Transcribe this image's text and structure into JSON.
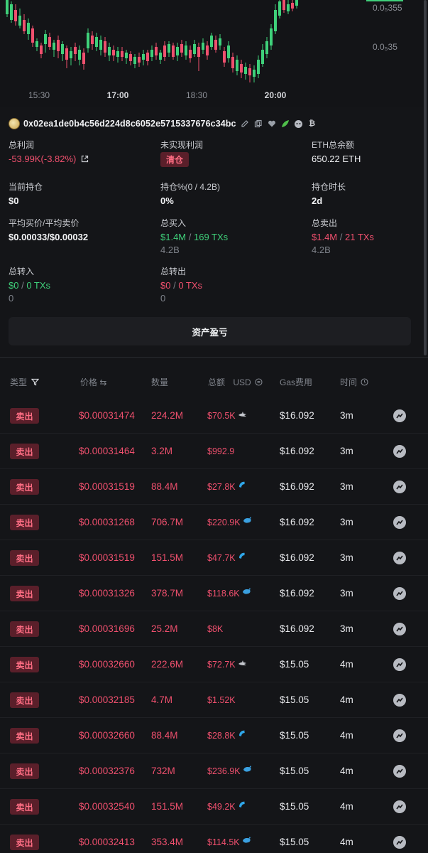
{
  "chart": {
    "price_ticks": [
      "0.0₅355",
      "0.0₅35"
    ],
    "time_ticks": [
      {
        "label": "15:30",
        "bold": false
      },
      {
        "label": "17:00",
        "bold": true
      },
      {
        "label": "18:30",
        "bold": false
      },
      {
        "label": "20:00",
        "bold": true
      }
    ]
  },
  "wallet": {
    "address": "0x02ea1de0b4c56d224d8c6052e5715337676c34bc"
  },
  "stats": {
    "total_profit_label": "总利润",
    "total_profit_value": "-53.99K(-3.82%)",
    "unrealized_label": "未实现利润",
    "unrealized_badge": "清仓",
    "eth_balance_label": "ETH总余额",
    "eth_balance_value": "650.22 ETH",
    "holding_label": "当前持仓",
    "holding_value": "$0",
    "holding_pct_label": "持仓%(0 / 4.2B)",
    "holding_pct_value": "0%",
    "holding_duration_label": "持仓时长",
    "holding_duration_value": "2d",
    "avg_price_label": "平均买价/平均卖价",
    "avg_price_value": "$0.00033/$0.00032",
    "total_buy_label": "总买入",
    "total_buy_amount": "$1.4M",
    "total_buy_sep": " / ",
    "total_buy_txs": "169 TXs",
    "total_buy_sub": "4.2B",
    "total_sell_label": "总卖出",
    "total_sell_amount": "$1.4M",
    "total_sell_sep": " / ",
    "total_sell_txs": "21 TXs",
    "total_sell_sub": "4.2B",
    "transfer_in_label": "总转入",
    "transfer_in_amount": "$0",
    "transfer_in_sep": " / ",
    "transfer_in_txs": "0 TXs",
    "transfer_in_sub": "0",
    "transfer_out_label": "总转出",
    "transfer_out_amount": "$0",
    "transfer_out_sep": " / ",
    "transfer_out_txs": "0 TXs",
    "transfer_out_sub": "0"
  },
  "pnl_button": "资产盈亏",
  "table": {
    "headers": {
      "type": "类型",
      "price": "价格 ⇆",
      "qty": "数量",
      "total": "总额",
      "usd": "USD",
      "gas": "Gas费用",
      "time": "时间"
    },
    "rows": [
      {
        "type": "卖出",
        "price": "$0.00031474",
        "qty": "224.2M",
        "amount": "$70.5K",
        "whale": "shark-icon",
        "gas": "$16.092",
        "time": "3m"
      },
      {
        "type": "卖出",
        "price": "$0.00031464",
        "qty": "3.2M",
        "amount": "$992.9",
        "whale": "",
        "gas": "$16.092",
        "time": "3m"
      },
      {
        "type": "卖出",
        "price": "$0.00031519",
        "qty": "88.4M",
        "amount": "$27.8K",
        "whale": "dolphin-icon",
        "gas": "$16.092",
        "time": "3m"
      },
      {
        "type": "卖出",
        "price": "$0.00031268",
        "qty": "706.7M",
        "amount": "$220.9K",
        "whale": "whale-icon",
        "gas": "$16.092",
        "time": "3m"
      },
      {
        "type": "卖出",
        "price": "$0.00031519",
        "qty": "151.5M",
        "amount": "$47.7K",
        "whale": "dolphin-icon",
        "gas": "$16.092",
        "time": "3m"
      },
      {
        "type": "卖出",
        "price": "$0.00031326",
        "qty": "378.7M",
        "amount": "$118.6K",
        "whale": "whale-icon",
        "gas": "$16.092",
        "time": "3m"
      },
      {
        "type": "卖出",
        "price": "$0.00031696",
        "qty": "25.2M",
        "amount": "$8K",
        "whale": "",
        "gas": "$16.092",
        "time": "3m"
      },
      {
        "type": "卖出",
        "price": "$0.00032660",
        "qty": "222.6M",
        "amount": "$72.7K",
        "whale": "shark-icon",
        "gas": "$15.05",
        "time": "4m"
      },
      {
        "type": "卖出",
        "price": "$0.00032185",
        "qty": "4.7M",
        "amount": "$1.52K",
        "whale": "",
        "gas": "$15.05",
        "time": "4m"
      },
      {
        "type": "卖出",
        "price": "$0.00032660",
        "qty": "88.4M",
        "amount": "$28.8K",
        "whale": "dolphin-icon",
        "gas": "$15.05",
        "time": "4m"
      },
      {
        "type": "卖出",
        "price": "$0.00032376",
        "qty": "732M",
        "amount": "$236.9K",
        "whale": "whale-icon",
        "gas": "$15.05",
        "time": "4m"
      },
      {
        "type": "卖出",
        "price": "$0.00032540",
        "qty": "151.5M",
        "amount": "$49.2K",
        "whale": "dolphin-icon",
        "gas": "$15.05",
        "time": "4m"
      },
      {
        "type": "卖出",
        "price": "$0.00032413",
        "qty": "353.4M",
        "amount": "$114.5K",
        "whale": "whale-icon",
        "gas": "$15.05",
        "time": "4m"
      }
    ]
  },
  "colors": {
    "up": "#3fd07a",
    "down": "#f0506e",
    "background": "#141518"
  }
}
